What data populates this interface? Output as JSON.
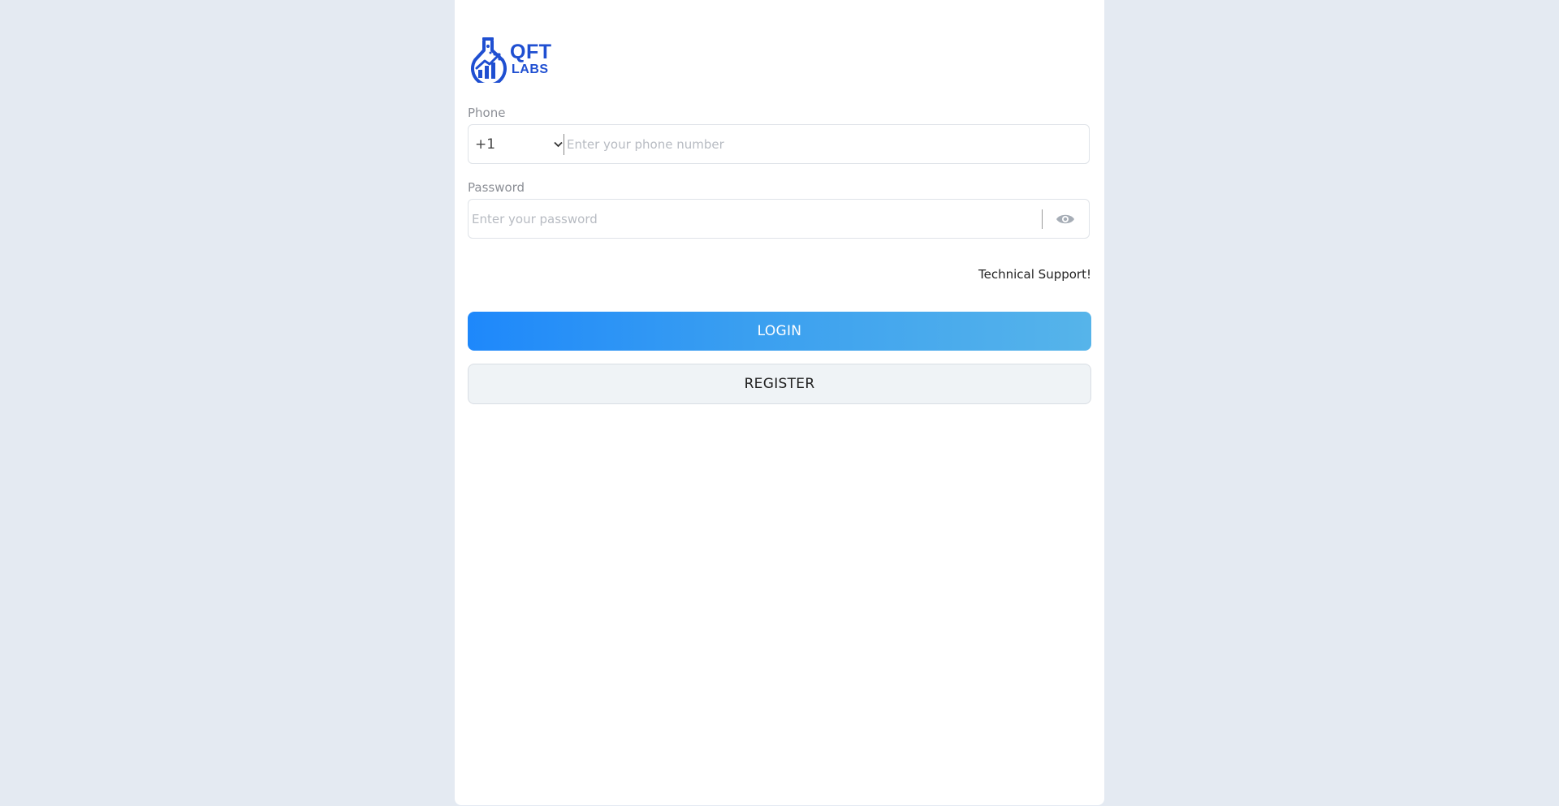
{
  "brand": {
    "line1": "QFT",
    "line2": "LABS",
    "color": "#1f4fd1"
  },
  "phone": {
    "label": "Phone",
    "country_code": "+1",
    "placeholder": "Enter your phone number"
  },
  "password": {
    "label": "Password",
    "placeholder": "Enter your password",
    "toggle_icon": "eye-icon"
  },
  "support": {
    "label": "Technical Support!"
  },
  "actions": {
    "login_label": "LOGIN",
    "register_label": "REGISTER"
  },
  "colors": {
    "page_background": "#e4eaf2",
    "card_background": "#ffffff",
    "login_gradient_start": "#1e88fb",
    "login_gradient_end": "#56b4ea",
    "register_background": "#eff3f6"
  }
}
